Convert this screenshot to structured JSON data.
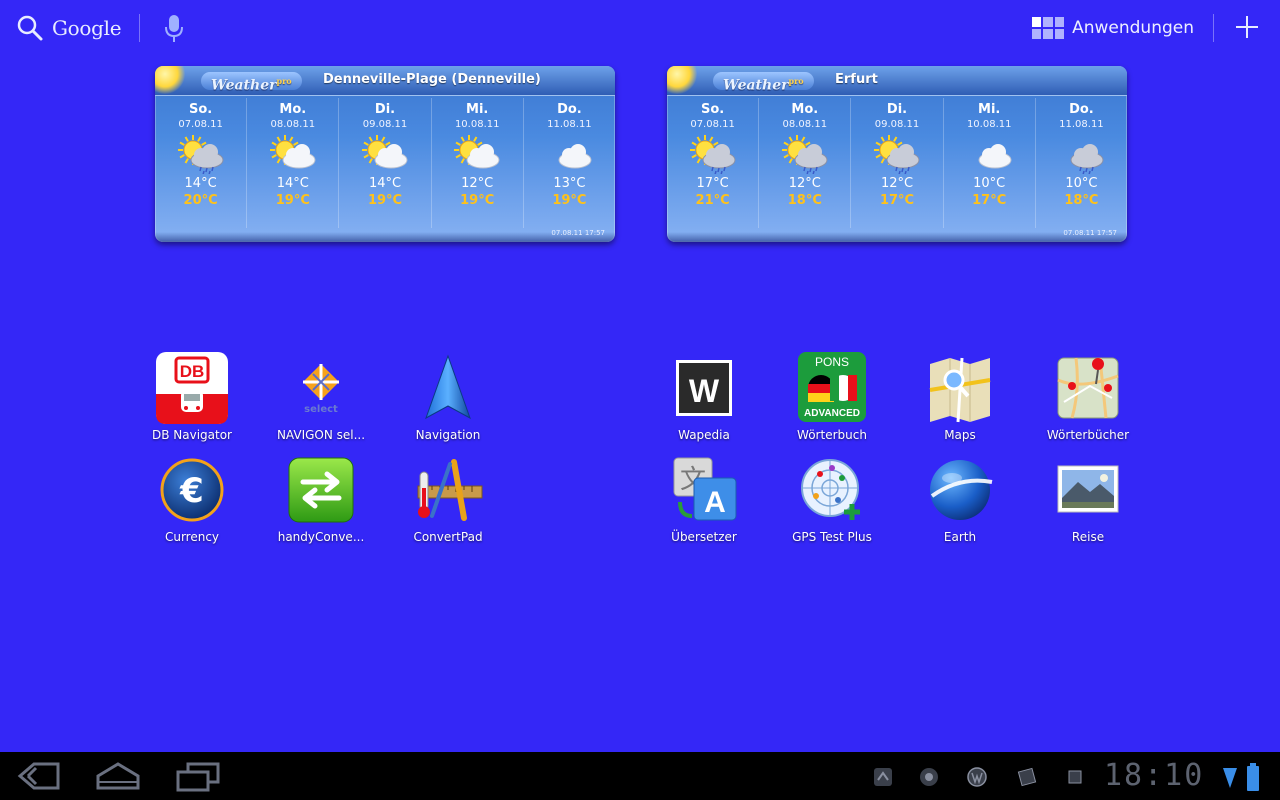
{
  "topbar": {
    "search_label": "Google",
    "apps_label": "Anwendungen"
  },
  "widgets": [
    {
      "brand": "Weather",
      "brand_sup": "pro",
      "city": "Denneville-Plage (Denneville)",
      "stamp": "07.08.11 17:57",
      "days": [
        {
          "name": "So.",
          "date": "07.08.11",
          "icon": "sun-cloud-rain",
          "min": "14°C",
          "max": "20°C"
        },
        {
          "name": "Mo.",
          "date": "08.08.11",
          "icon": "sun-cloud",
          "min": "14°C",
          "max": "19°C"
        },
        {
          "name": "Di.",
          "date": "09.08.11",
          "icon": "sun-cloud",
          "min": "14°C",
          "max": "19°C"
        },
        {
          "name": "Mi.",
          "date": "10.08.11",
          "icon": "sun-cloud",
          "min": "12°C",
          "max": "19°C"
        },
        {
          "name": "Do.",
          "date": "11.08.11",
          "icon": "cloud",
          "min": "13°C",
          "max": "19°C"
        }
      ]
    },
    {
      "brand": "Weather",
      "brand_sup": "pro",
      "city": "Erfurt",
      "stamp": "07.08.11 17:57",
      "days": [
        {
          "name": "So.",
          "date": "07.08.11",
          "icon": "sun-cloud-rain",
          "min": "17°C",
          "max": "21°C"
        },
        {
          "name": "Mo.",
          "date": "08.08.11",
          "icon": "sun-cloud-rain",
          "min": "12°C",
          "max": "18°C"
        },
        {
          "name": "Di.",
          "date": "09.08.11",
          "icon": "sun-cloud-rain",
          "min": "12°C",
          "max": "17°C"
        },
        {
          "name": "Mi.",
          "date": "10.08.11",
          "icon": "cloud",
          "min": "10°C",
          "max": "17°C"
        },
        {
          "name": "Do.",
          "date": "11.08.11",
          "icon": "cloud-rain",
          "min": "10°C",
          "max": "18°C"
        }
      ]
    }
  ],
  "apps": {
    "db_navigator": "DB Navigator",
    "navigon_select": "NAVIGON sel...",
    "navigation": "Navigation",
    "currency": "Currency",
    "handyconverter": "handyConve...",
    "convertpad": "ConvertPad",
    "wapedia": "Wapedia",
    "woerterbuch": "Wörterbuch",
    "maps": "Maps",
    "woerterbuecher": "Wörterbücher",
    "uebersetzer": "Übersetzer",
    "gps_test_plus": "GPS Test Plus",
    "earth": "Earth",
    "reise": "Reise"
  },
  "icon_text": {
    "db": "DB",
    "navigon_sub": "select",
    "wapedia": "W",
    "pons": "PONS",
    "pons_sub": "ADVANCED",
    "currency": "€"
  },
  "sysbar": {
    "clock": "18:10"
  },
  "colors": {
    "wallpaper": "#3427f7",
    "temp_max": "#ffc21a",
    "sysbar": "#000000"
  }
}
